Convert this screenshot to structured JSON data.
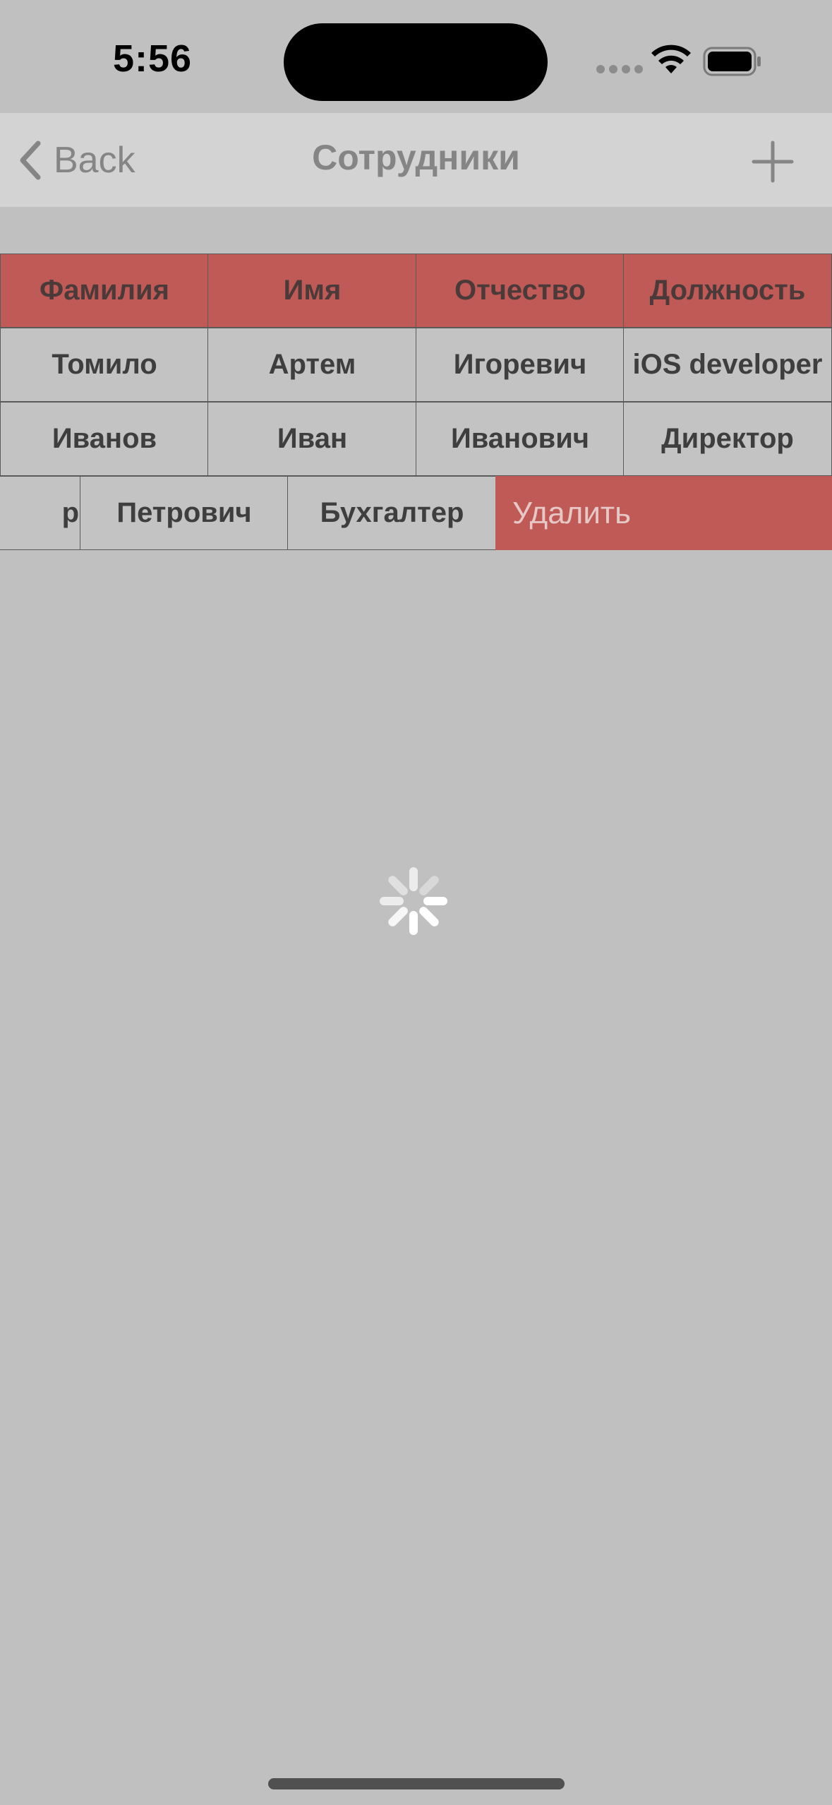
{
  "status_bar": {
    "time": "5:56"
  },
  "nav": {
    "back_label": "Back",
    "title": "Сотрудники"
  },
  "table": {
    "headers": [
      "Фамилия",
      "Имя",
      "Отчество",
      "Должность"
    ],
    "rows": [
      [
        "Томило",
        "Артем",
        "Игоревич",
        "iOS developer"
      ],
      [
        "Иванов",
        "Иван",
        "Иванович",
        "Директор"
      ]
    ],
    "swiped_row": {
      "cells": [
        "р",
        "Петрович",
        "Бухгалтер"
      ],
      "delete_label": "Удалить"
    }
  },
  "colors": {
    "background": "#c0c0c0",
    "nav_background": "#d3d3d3",
    "header_red": "#c05a57",
    "delete_red": "#c05a57"
  }
}
